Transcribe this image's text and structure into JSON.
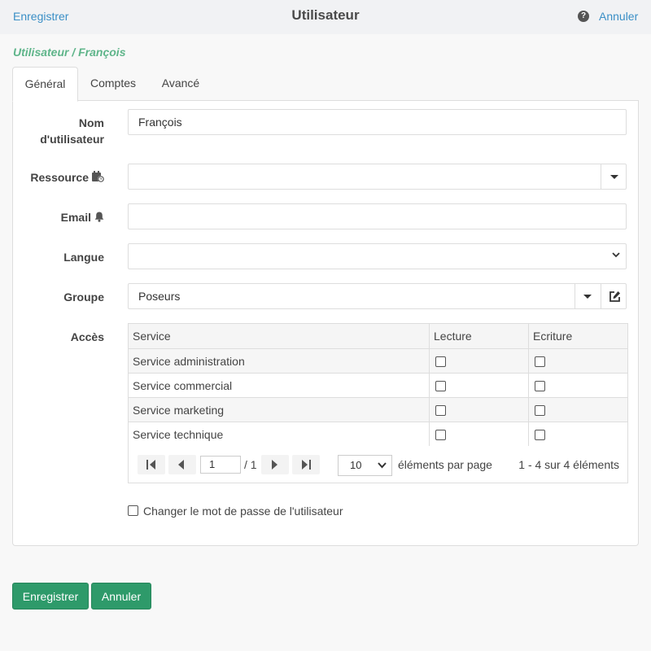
{
  "header": {
    "save_link": "Enregistrer",
    "title": "Utilisateur",
    "help_icon": "question-circle-icon",
    "cancel_link": "Annuler"
  },
  "breadcrumb": "Utilisateur / François",
  "tabs": [
    {
      "label": "Général",
      "active": true
    },
    {
      "label": "Comptes",
      "active": false
    },
    {
      "label": "Avancé",
      "active": false
    }
  ],
  "form": {
    "username": {
      "label_line1": "Nom",
      "label_line2": "d'utilisateur",
      "value": "François"
    },
    "resource": {
      "label": "Ressource",
      "icon": "calendar-clock-icon",
      "value": ""
    },
    "email": {
      "label": "Email",
      "icon": "bell-icon",
      "value": ""
    },
    "language": {
      "label": "Langue",
      "value": ""
    },
    "group": {
      "label": "Groupe",
      "value": "Poseurs",
      "edit_icon": "edit-icon"
    },
    "access": {
      "label": "Accès",
      "columns": [
        "Service",
        "Lecture",
        "Ecriture"
      ],
      "rows": [
        {
          "service": "Service administration",
          "read": false,
          "write": false
        },
        {
          "service": "Service commercial",
          "read": false,
          "write": false
        },
        {
          "service": "Service marketing",
          "read": false,
          "write": false
        },
        {
          "service": "Service technique",
          "read": false,
          "write": false
        }
      ],
      "pager": {
        "page": "1",
        "total_pages": "/ 1",
        "page_size": "10",
        "page_size_label": "éléments par page",
        "info": "1 - 4 sur 4 éléments"
      }
    },
    "change_password": {
      "label": "Changer le mot de passe de l'utilisateur",
      "checked": false
    }
  },
  "footer": {
    "save_button": "Enregistrer",
    "cancel_button": "Annuler"
  },
  "colors": {
    "accent_link": "#3a8fc6",
    "breadcrumb": "#5fb58a",
    "primary_button": "#2e9a6a"
  }
}
